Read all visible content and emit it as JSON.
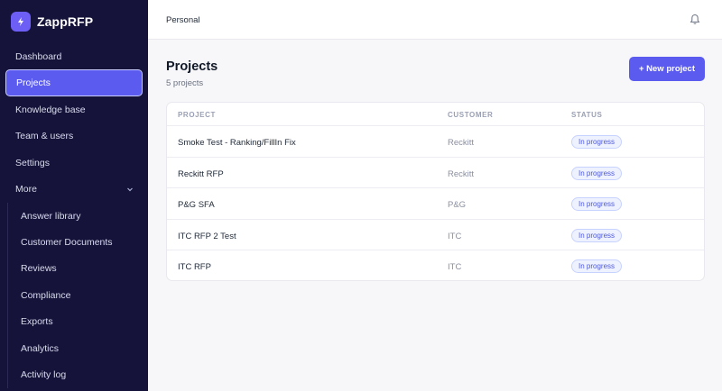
{
  "brand": {
    "name": "ZappRFP",
    "logo_icon": "bolt-icon",
    "logo_color": "#6d5ef5"
  },
  "sidebar": {
    "items": [
      {
        "label": "Dashboard",
        "active": false
      },
      {
        "label": "Projects",
        "active": true
      },
      {
        "label": "Knowledge base",
        "active": false
      },
      {
        "label": "Team & users",
        "active": false
      },
      {
        "label": "Settings",
        "active": false
      },
      {
        "label": "More",
        "active": false,
        "expanded": true
      }
    ],
    "sub_items": [
      {
        "label": "Answer library"
      },
      {
        "label": "Customer Documents"
      },
      {
        "label": "Reviews"
      },
      {
        "label": "Compliance"
      },
      {
        "label": "Exports"
      },
      {
        "label": "Analytics"
      },
      {
        "label": "Activity log"
      }
    ]
  },
  "topbar": {
    "workspace": "Personal",
    "notification_icon": "bell-icon"
  },
  "page": {
    "title": "Projects",
    "subtitle": "5 projects",
    "new_button_label": "+ New project"
  },
  "table": {
    "columns": [
      "PROJECT",
      "CUSTOMER",
      "STATUS"
    ],
    "rows": [
      {
        "project": "Smoke Test - Ranking/FillIn Fix",
        "customer": "Reckitt",
        "status": "In progress"
      },
      {
        "project": "Reckitt RFP",
        "customer": "Reckitt",
        "status": "In progress"
      },
      {
        "project": "P&G SFA",
        "customer": "P&G",
        "status": "In progress"
      },
      {
        "project": "ITC RFP 2 Test",
        "customer": "ITC",
        "status": "In progress"
      },
      {
        "project": "ITC RFP",
        "customer": "ITC",
        "status": "In progress"
      }
    ]
  },
  "colors": {
    "sidebar_bg": "#15133a",
    "accent": "#5b5bf0",
    "status_badge_text": "#4f59d9"
  }
}
